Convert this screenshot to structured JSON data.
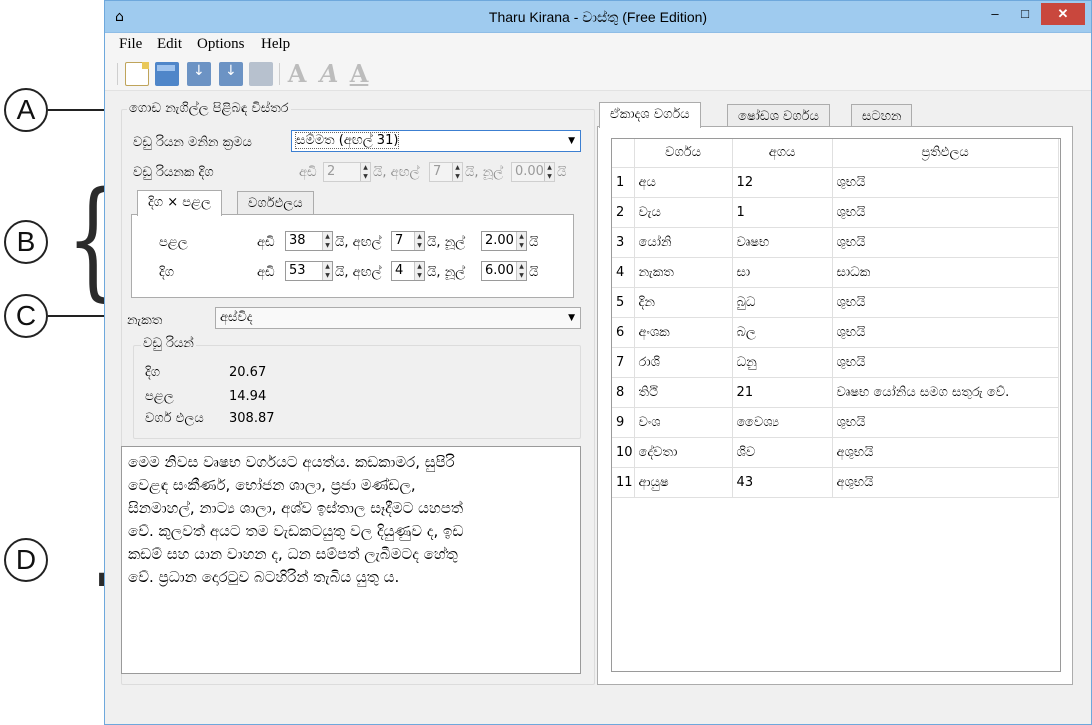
{
  "window": {
    "title": "Tharu Kirana - වාස්තු (Free Edition)",
    "controls": {
      "minimize": "–",
      "maximize": "□",
      "close": "✕"
    }
  },
  "menu": [
    "File",
    "Edit",
    "Options",
    "Help"
  ],
  "annotations": {
    "a": "A",
    "b": "B",
    "c": "C",
    "d": "D"
  },
  "left": {
    "group_a_title": "ගොඩ නැගිල්ල පිළිබඳ විස්තර",
    "method_label": "වඩු රියන මනින ක්‍රමය",
    "method_value": "සම්මත (අඟල් 31)",
    "length_label": "වඩු රියනක දිග",
    "length_spin": {
      "adi_label": "අඩි",
      "adi": "2",
      "yi1": "යි, අඟල්",
      "angal": "7",
      "yi2": "යි, නූල්",
      "nool": "0.00",
      "yi3": "යි"
    },
    "tabs": [
      "දිග × පළල",
      "වර්ගඵලය"
    ],
    "rows": [
      {
        "label": "පළල",
        "adi_label": "අඩි",
        "adi": "38",
        "yi1": "යි, අඟල්",
        "angal": "7",
        "yi2": "යි, නූල්",
        "nool": "2.00",
        "yi3": "යි"
      },
      {
        "label": "දිග",
        "adi_label": "අඩි",
        "adi": "53",
        "yi1": "යි, අඟල්",
        "angal": "4",
        "yi2": "යි, නූල්",
        "nool": "6.00",
        "yi3": "යි"
      }
    ],
    "nakatha_label": "නැකත",
    "nakatha_value": "අස්විද",
    "vadu_title": "වඩු රියන්",
    "vadu": [
      {
        "label": "දිග",
        "value": "20.67"
      },
      {
        "label": "පළල",
        "value": "14.94"
      },
      {
        "label": "වර්ග ඵලය",
        "value": "308.87"
      }
    ],
    "description": "මෙම නිවස වෘෂභ වර්ගයට අයත්ය. කඩකාමර, සුපිරි\nවෙළඳ සංකීර්ණ, භෝජන ශාලා, ප්‍රජා මණ්ඩල,\nසිනමාහල්, නාට්‍ය ශාලා, අශ්ව ඉස්තාල සෑදීමට යහපත්\nවේ. කුලවත් අයට තම වැඩකටයුතු වල දියුණුව ද, ඉඩ\nකඩම් සහ යාන වාහන ද, ධන සම්පත් ලැබීමටද හේතු\nවේ. ප්‍රධාන දොරටුව බටහිරින් තැබිය යුතු ය."
  },
  "right": {
    "tabs": [
      "ඒකාදශ වර්ගය",
      "ෂෝඩශ වර්ගය",
      "සටහන"
    ],
    "columns": [
      "වර්ගය",
      "අගය",
      "ප්‍රතිඵලය"
    ],
    "rows": [
      {
        "n": "1",
        "c1": "අය",
        "c2": "12",
        "c3": "ශුභයි"
      },
      {
        "n": "2",
        "c1": "වැය",
        "c2": "1",
        "c3": "ශුභයි"
      },
      {
        "n": "3",
        "c1": "යෝනි",
        "c2": "වෘෂභ",
        "c3": "ශුභයි"
      },
      {
        "n": "4",
        "c1": "නැකත",
        "c2": "සා",
        "c3": "සාධක"
      },
      {
        "n": "5",
        "c1": "දින",
        "c2": "බුධ",
        "c3": "ශුභයි"
      },
      {
        "n": "6",
        "c1": "අංශක",
        "c2": "බල",
        "c3": "ශුභයි"
      },
      {
        "n": "7",
        "c1": "රාශි",
        "c2": "ධනු",
        "c3": "ශුභයි"
      },
      {
        "n": "8",
        "c1": "තිථි",
        "c2": "21",
        "c3": "වෘෂභ යෝනිය සමග සතුරු වේ."
      },
      {
        "n": "9",
        "c1": "වංශ",
        "c2": "වෛශ්‍ය",
        "c3": "ශුභයි"
      },
      {
        "n": "10",
        "c1": "දේවතා",
        "c2": "ශිව",
        "c3": "අශුභයි"
      },
      {
        "n": "11",
        "c1": "ආයුෂ",
        "c2": "43",
        "c3": "අශුභයි"
      }
    ]
  }
}
